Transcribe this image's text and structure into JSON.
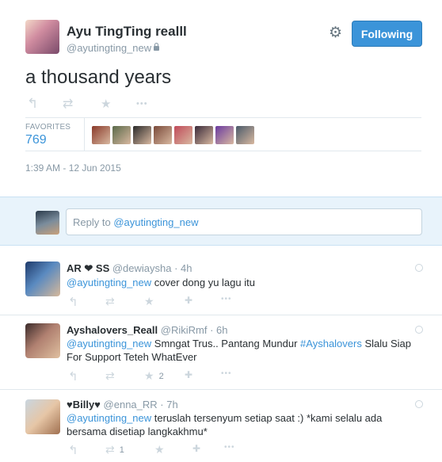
{
  "tweet": {
    "author_name": "Ayu TingTing realll",
    "author_handle": "@ayutingting_new",
    "follow_label": "Following",
    "text": "a thousand years",
    "favorites_label": "FAVORITES",
    "favorites_count": "769",
    "timestamp": "1:39 AM - 12 Jun 2015",
    "favoriters_colors": [
      "#8a3a2a",
      "#5a6a4a",
      "#2a2a2a",
      "#7a4a3a",
      "#c04a5a",
      "#3a2a3a",
      "#6a3aa0",
      "#4a5a6a"
    ]
  },
  "reply_box": {
    "prefix": "Reply to ",
    "mention": "@ayutingting_new"
  },
  "replies": [
    {
      "name": "AR ❤ SS",
      "handle": "@dewiaysha",
      "time": "· 4h",
      "mention": "@ayutingting_new",
      "text": " cover dong yu lagu itu",
      "retweets": "",
      "favorites": ""
    },
    {
      "name": "Ayshalovers_Reall",
      "handle": "@RikiRmf",
      "time": "· 6h",
      "mention": "@ayutingting_new",
      "text_a": " Smngat Trus.. Pantang Mundur ",
      "hashtag": "#Ayshalovers",
      "text_b": " Slalu Siap For Support Teteh WhatEver",
      "retweets": "",
      "favorites": "2"
    },
    {
      "name": "♥Billy♥",
      "handle": "@enna_RR",
      "time": "· 7h",
      "mention": "@ayutingting_new",
      "text": " teruslah tersenyum setiap saat :) *kami selalu ada bersama disetiap langkakhmu*",
      "retweets": "1",
      "favorites": ""
    }
  ],
  "icons": {
    "reply": "↰",
    "retweet": "⇄",
    "favorite": "★",
    "more": "•••",
    "follow_user": "✚",
    "gear": "⚙"
  }
}
